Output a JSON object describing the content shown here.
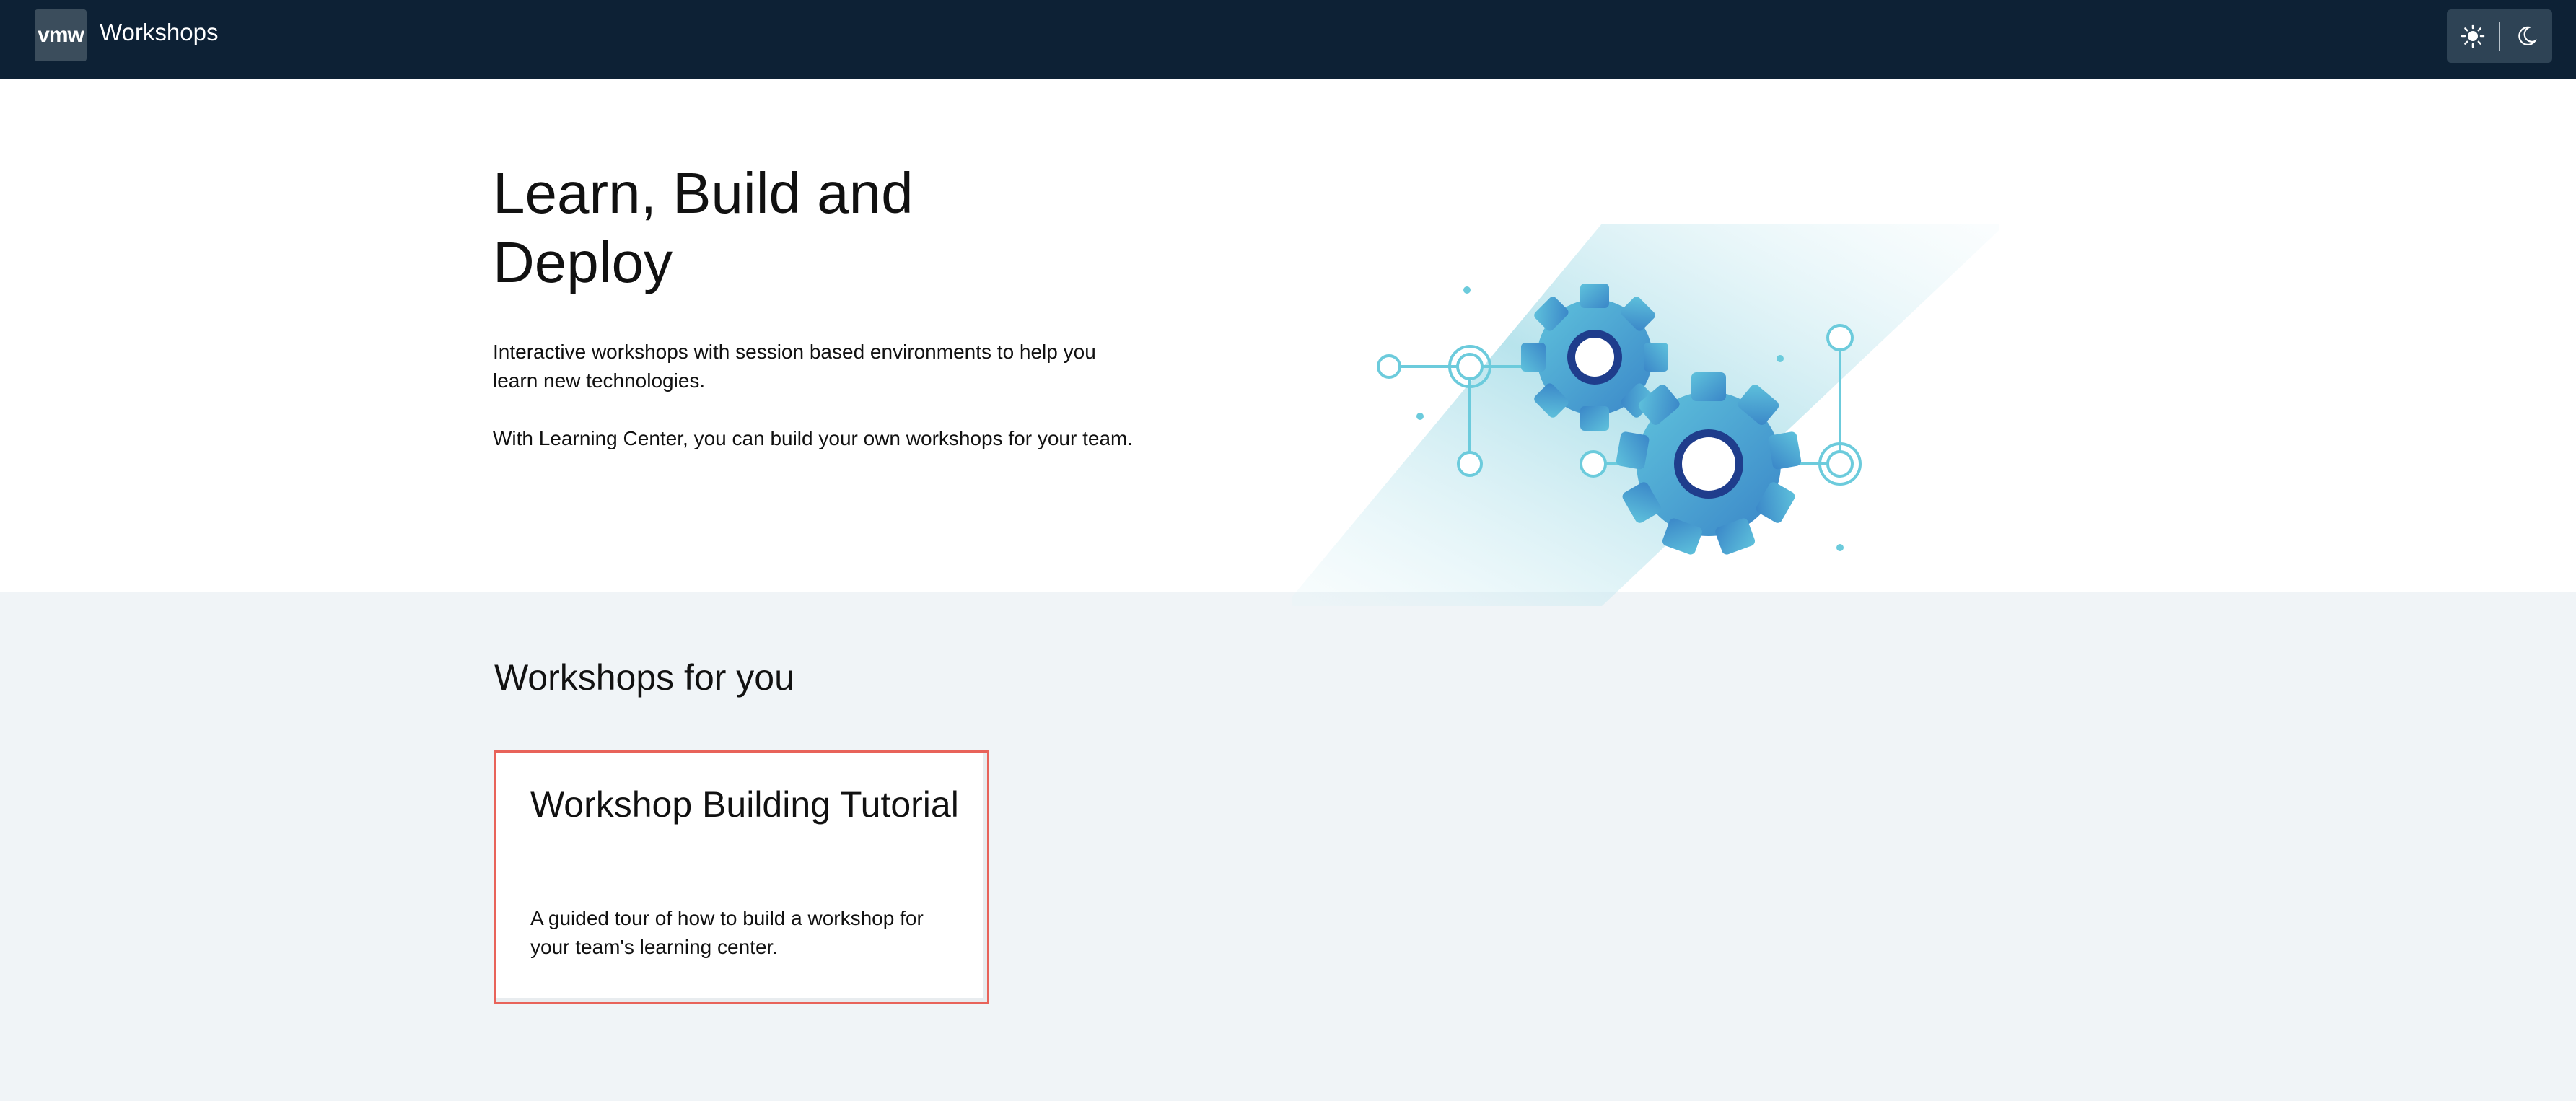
{
  "header": {
    "logo_text": "vmw",
    "title": "Workshops",
    "theme_toggle": {
      "light_icon": "sun-icon",
      "dark_icon": "moon-icon"
    }
  },
  "hero": {
    "title": "Learn, Build and Deploy",
    "paragraph_1": "Interactive workshops with session based environments to help you learn new technologies.",
    "paragraph_2": "With Learning Center, you can build your own workshops for your team.",
    "illustration": "gears-illustration"
  },
  "workshops": {
    "section_title": "Workshops for you",
    "cards": [
      {
        "title": "Workshop Building Tutorial",
        "description": "A guided tour of how to build a workshop for your team's learning center."
      }
    ]
  },
  "colors": {
    "header_bg": "#0d2135",
    "page_bg": "#f0f4f7",
    "card_selected_border": "#e8635a",
    "gear_blue": "#4aa3d6",
    "accent_teal": "#6ccbdc"
  }
}
